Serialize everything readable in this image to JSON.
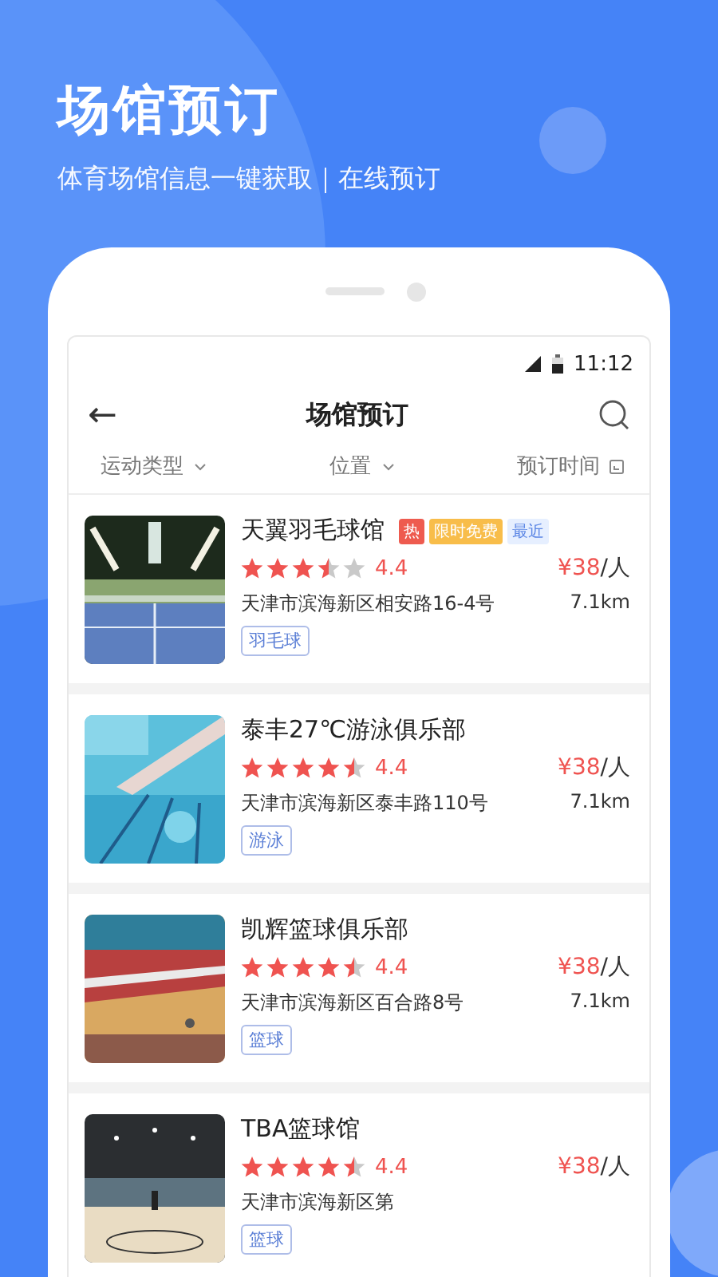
{
  "promo": {
    "title": "场馆预订",
    "subtitle": "体育场馆信息一键获取｜在线预订"
  },
  "status_bar": {
    "time": "11:12"
  },
  "nav": {
    "back": "←",
    "title": "场馆预订"
  },
  "filters": [
    {
      "label": "运动类型",
      "kind": "dropdown"
    },
    {
      "label": "位置",
      "kind": "dropdown"
    },
    {
      "label": "预订时间",
      "kind": "calendar"
    }
  ],
  "venues": [
    {
      "name": "天翼羽毛球馆",
      "badges": [
        {
          "text": "热",
          "kind": "hot"
        },
        {
          "text": "限时免费",
          "kind": "promo"
        },
        {
          "text": "最近",
          "kind": "near"
        }
      ],
      "stars": 3.5,
      "rating": "4.4",
      "price": "¥38",
      "unit": "/人",
      "address": "天津市滨海新区相安路16-4号",
      "distance": "7.1km",
      "tag": "羽毛球"
    },
    {
      "name": "泰丰27℃游泳俱乐部",
      "stars": 4.5,
      "rating": "4.4",
      "price": "¥38",
      "unit": "/人",
      "address": "天津市滨海新区泰丰路110号",
      "distance": "7.1km",
      "tag": "游泳"
    },
    {
      "name": "凯辉篮球俱乐部",
      "stars": 4.5,
      "rating": "4.4",
      "price": "¥38",
      "unit": "/人",
      "address": "天津市滨海新区百合路8号",
      "distance": "7.1km",
      "tag": "篮球"
    },
    {
      "name": "TBA篮球馆",
      "stars": 4.5,
      "rating": "4.4",
      "price": "¥38",
      "unit": "/人",
      "address": "天津市滨海新区第",
      "tag": "篮球"
    }
  ]
}
